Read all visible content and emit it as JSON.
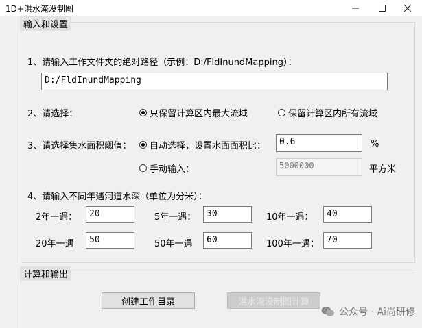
{
  "window": {
    "title": "1D+洪水淹没制图",
    "minimize_icon": "minimize-icon",
    "maximize_icon": "maximize-icon",
    "close_icon": "close-icon"
  },
  "input_group": {
    "title": "输入和设置",
    "q1": {
      "label": "1、请输入工作文件夹的绝对路径（示例：D:/FldInundMapping）：",
      "value": "D:/FldInundMapping"
    },
    "q2": {
      "label": "2、请选择：",
      "option1": "只保留计算区内最大流域",
      "option2": "保留计算区内所有流域",
      "selected": "option1"
    },
    "q3": {
      "label": "3、请选择集水面积阈值：",
      "auto_label": "自动选择，设置水面面积比：",
      "auto_value": "0.6",
      "auto_unit": "%",
      "manual_label": "手动输入：",
      "manual_value": "5000000",
      "manual_unit": "平方米",
      "selected": "auto"
    },
    "q4": {
      "label": "4、请输入不同年遇河道水深（单位为分米）：",
      "rows": [
        [
          {
            "label": "2年一遇：",
            "value": "20"
          },
          {
            "label": "5年一遇：",
            "value": "30"
          },
          {
            "label": "10年一遇：",
            "value": "40"
          }
        ],
        [
          {
            "label": "20年一遇",
            "value": "50"
          },
          {
            "label": "50年一遇",
            "value": "60"
          },
          {
            "label": "100年一遇：",
            "value": "70"
          }
        ]
      ]
    }
  },
  "output_group": {
    "title": "计算和输出",
    "create_button": "创建工作目录",
    "compute_button": "洪水淹没制图计算"
  },
  "watermark": {
    "text": "公众号 · Ai尚研修",
    "icon": "wechat-icon"
  }
}
